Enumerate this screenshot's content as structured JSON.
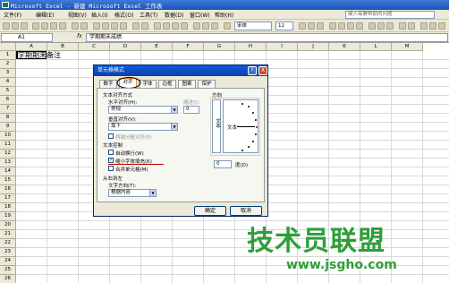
{
  "window": {
    "title": "Microsoft Excel - 新建 Microsoft Excel 工作表"
  },
  "menu": {
    "items": [
      "文件(F)",
      "编辑(E)",
      "视图(V)",
      "插入(I)",
      "格式(O)",
      "工具(T)",
      "数据(D)",
      "窗口(W)",
      "帮助(H)"
    ],
    "help_placeholder": "键入需要帮助的问题"
  },
  "toolbar": {
    "font_name": "宋体",
    "font_size": "12"
  },
  "formula_bar": {
    "name_box": "A1",
    "fx": "fx",
    "content": "学期期末成绩"
  },
  "sheet": {
    "columns": [
      "A",
      "B",
      "C",
      "D",
      "E",
      "F",
      "G",
      "H",
      "I",
      "J",
      "K",
      "L",
      "M"
    ],
    "rows": [
      "1",
      "2",
      "3",
      "4",
      "5",
      "6",
      "7",
      "8",
      "9",
      "10",
      "11",
      "12",
      "13",
      "14",
      "15",
      "16",
      "17",
      "18",
      "19",
      "20",
      "21",
      "22",
      "23",
      "24",
      "25",
      "26"
    ],
    "a1": "学期期末",
    "b1": "备注"
  },
  "dialog": {
    "title": "单元格格式",
    "tabs": [
      "数字",
      "对齐",
      "字体",
      "边框",
      "图案",
      "保护"
    ],
    "text_align_group": "文本对齐方式",
    "horizontal_label": "水平对齐(H):",
    "horizontal_value": "常规",
    "indent_label": "缩进(I):",
    "indent_value": "0",
    "vertical_label": "垂直对齐(V):",
    "vertical_value": "靠下",
    "distributed_label": "两端分散对齐(E)",
    "text_control_group": "文本控制",
    "wrap_label": "自动换行(W)",
    "shrink_label": "缩小字体填充(K)",
    "shrink_check": "✓",
    "merge_label": "合并单元格(M)",
    "rtl_group": "从右到左",
    "direction_label": "文字方向(T):",
    "direction_value": "根据内容",
    "orientation_group": "方向",
    "orientation_vertical": "文本",
    "orientation_horizontal": "文本",
    "degree_value": "0",
    "degree_label": "度(D)",
    "ok": "确定",
    "cancel": "取消",
    "help_btn": "?",
    "close_btn": "X"
  },
  "watermark": {
    "title": "技术员联盟",
    "url": "www.jsgho.com"
  }
}
